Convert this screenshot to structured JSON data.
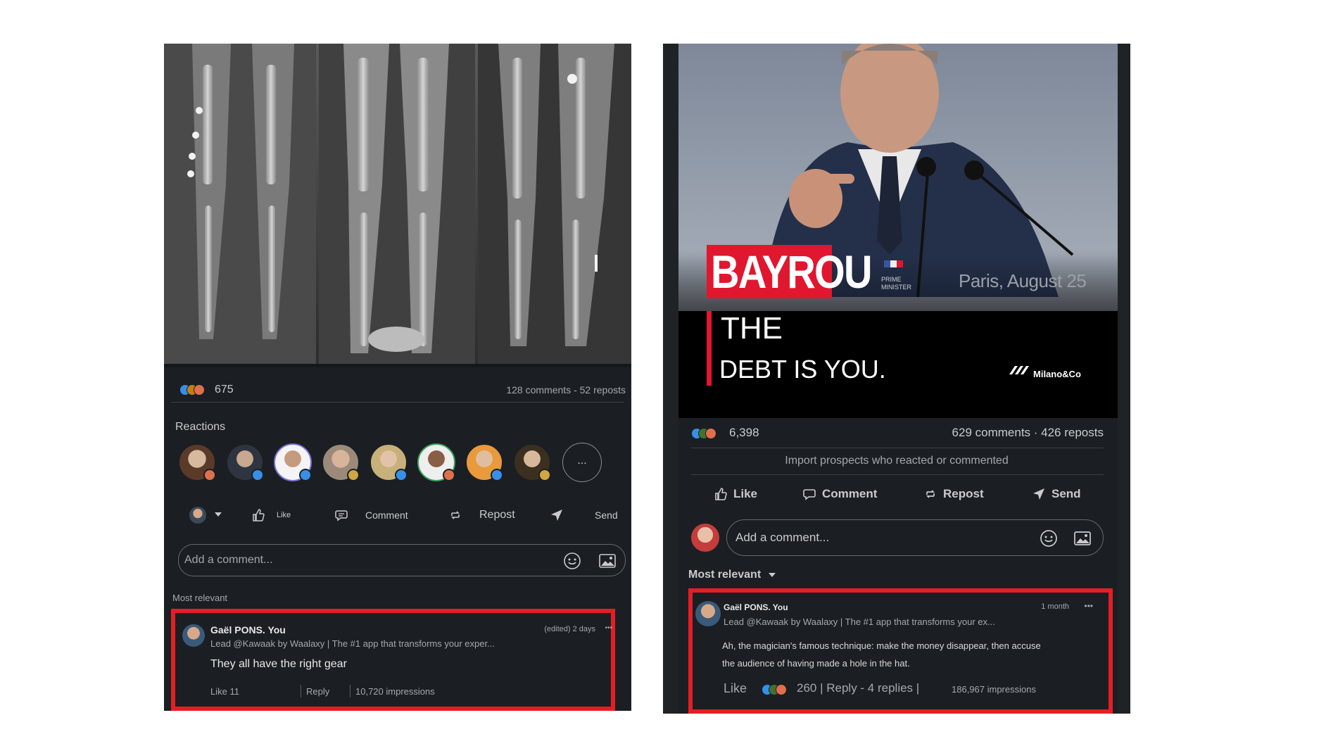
{
  "left": {
    "reaction_count": "675",
    "stats": "128 comments - 52 reposts",
    "reactions_heading": "Reactions",
    "more_reactions": "...",
    "actions": {
      "like": "Like",
      "comment": "Comment",
      "repost": "Repost",
      "send": "Send"
    },
    "comment_input": {
      "placeholder": "Add a comment..."
    },
    "sort_label": "Most relevant",
    "comment": {
      "author": "Gaël PONS. You",
      "headline": "Lead @Kawaak by Waalaxy | The #1 app that transforms your exper...",
      "time": "(edited) 2 days",
      "menu": "•••",
      "text": "They all have the right gear",
      "like_label": "Like 11",
      "reply_label": "Reply",
      "impressions": "10,720 impressions"
    },
    "colors": {
      "background": "#1b1f23",
      "highlight": "#e41e25"
    },
    "icons": [
      "like-icon",
      "comment-icon",
      "repost-icon",
      "send-icon",
      "emoji-icon",
      "image-icon"
    ]
  },
  "right": {
    "banner": {
      "name": "BAYROU",
      "role_line1": "PRIME",
      "role_line2": "MINISTER",
      "location": "Paris, August 25",
      "line1": "THE",
      "line2": "DEBT IS YOU.",
      "brand": "Milano&Co"
    },
    "reaction_count": "6,398",
    "stats": "629 comments · 426 reposts",
    "import_prospects": "Import prospects who reacted or commented",
    "actions": {
      "like": "Like",
      "comment": "Comment",
      "repost": "Repost",
      "send": "Send"
    },
    "comment_input": {
      "placeholder": "Add a comment..."
    },
    "sort_label": "Most relevant",
    "comment": {
      "author": "Gaël PONS. You",
      "headline": "Lead @Kawaak by Waalaxy | The #1 app that transforms your ex...",
      "time": "1 month",
      "menu": "•••",
      "text_line1": "Ah, the magician's famous technique: make the money disappear, then accuse",
      "text_line2": "the audience of having made a hole in the hat.",
      "like_label": "Like",
      "reaction_stats": "260 | Reply - 4 replies |",
      "impressions": "186,967 impressions"
    },
    "colors": {
      "banner_red": "#e0172f",
      "highlight": "#e41e25"
    }
  }
}
